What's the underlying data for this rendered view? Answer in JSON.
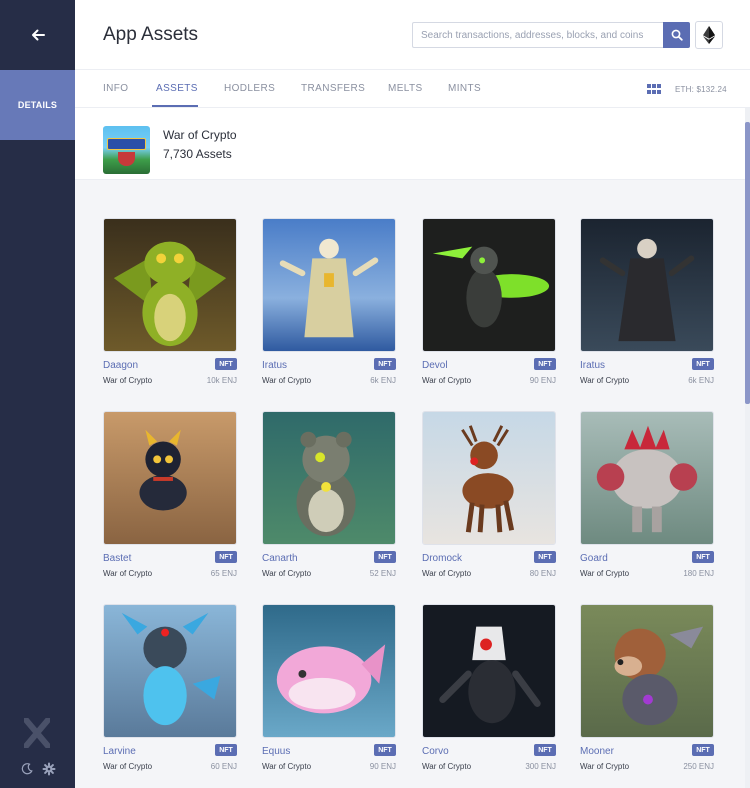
{
  "sidebar": {
    "details_label": "DETAILS"
  },
  "header": {
    "title": "App Assets",
    "search_placeholder": "Search transactions, addresses, blocks, and coins"
  },
  "tabs": [
    {
      "label": "INFO"
    },
    {
      "label": "ASSETS"
    },
    {
      "label": "HODLERS"
    },
    {
      "label": "TRANSFERS"
    },
    {
      "label": "MELTS"
    },
    {
      "label": "MINTS"
    }
  ],
  "active_tab": "ASSETS",
  "eth_price": "ETH: $132.24",
  "collection": {
    "name": "War of Crypto",
    "count": "7,730 Assets"
  },
  "assets": [
    {
      "name": "Daagon",
      "badge": "NFT",
      "collection": "War of Crypto",
      "price": "10k ENJ"
    },
    {
      "name": "Iratus",
      "badge": "NFT",
      "collection": "War of Crypto",
      "price": "6k ENJ"
    },
    {
      "name": "Devol",
      "badge": "NFT",
      "collection": "War of Crypto",
      "price": "90 ENJ"
    },
    {
      "name": "Iratus",
      "badge": "NFT",
      "collection": "War of Crypto",
      "price": "6k ENJ"
    },
    {
      "name": "Bastet",
      "badge": "NFT",
      "collection": "War of Crypto",
      "price": "65 ENJ"
    },
    {
      "name": "Canarth",
      "badge": "NFT",
      "collection": "War of Crypto",
      "price": "52 ENJ"
    },
    {
      "name": "Dromock",
      "badge": "NFT",
      "collection": "War of Crypto",
      "price": "80 ENJ"
    },
    {
      "name": "Goard",
      "badge": "NFT",
      "collection": "War of Crypto",
      "price": "180 ENJ"
    },
    {
      "name": "Larvine",
      "badge": "NFT",
      "collection": "War of Crypto",
      "price": "60 ENJ"
    },
    {
      "name": "Equus",
      "badge": "NFT",
      "collection": "War of Crypto",
      "price": "90 ENJ"
    },
    {
      "name": "Corvo",
      "badge": "NFT",
      "collection": "War of Crypto",
      "price": "300 ENJ"
    },
    {
      "name": "Mooner",
      "badge": "NFT",
      "collection": "War of Crypto",
      "price": "250 ENJ"
    }
  ],
  "colors": {
    "sidebar_bg": "#262d47",
    "accent": "#5b6db3",
    "details_bg": "#6779b8"
  },
  "icons": {
    "back": "arrow-left-icon",
    "search": "search-icon",
    "eth": "ethereum-icon",
    "grid": "grid-view-icon",
    "theme": "moon-icon",
    "settings": "gear-icon",
    "logo": "enjin-x-logo"
  }
}
